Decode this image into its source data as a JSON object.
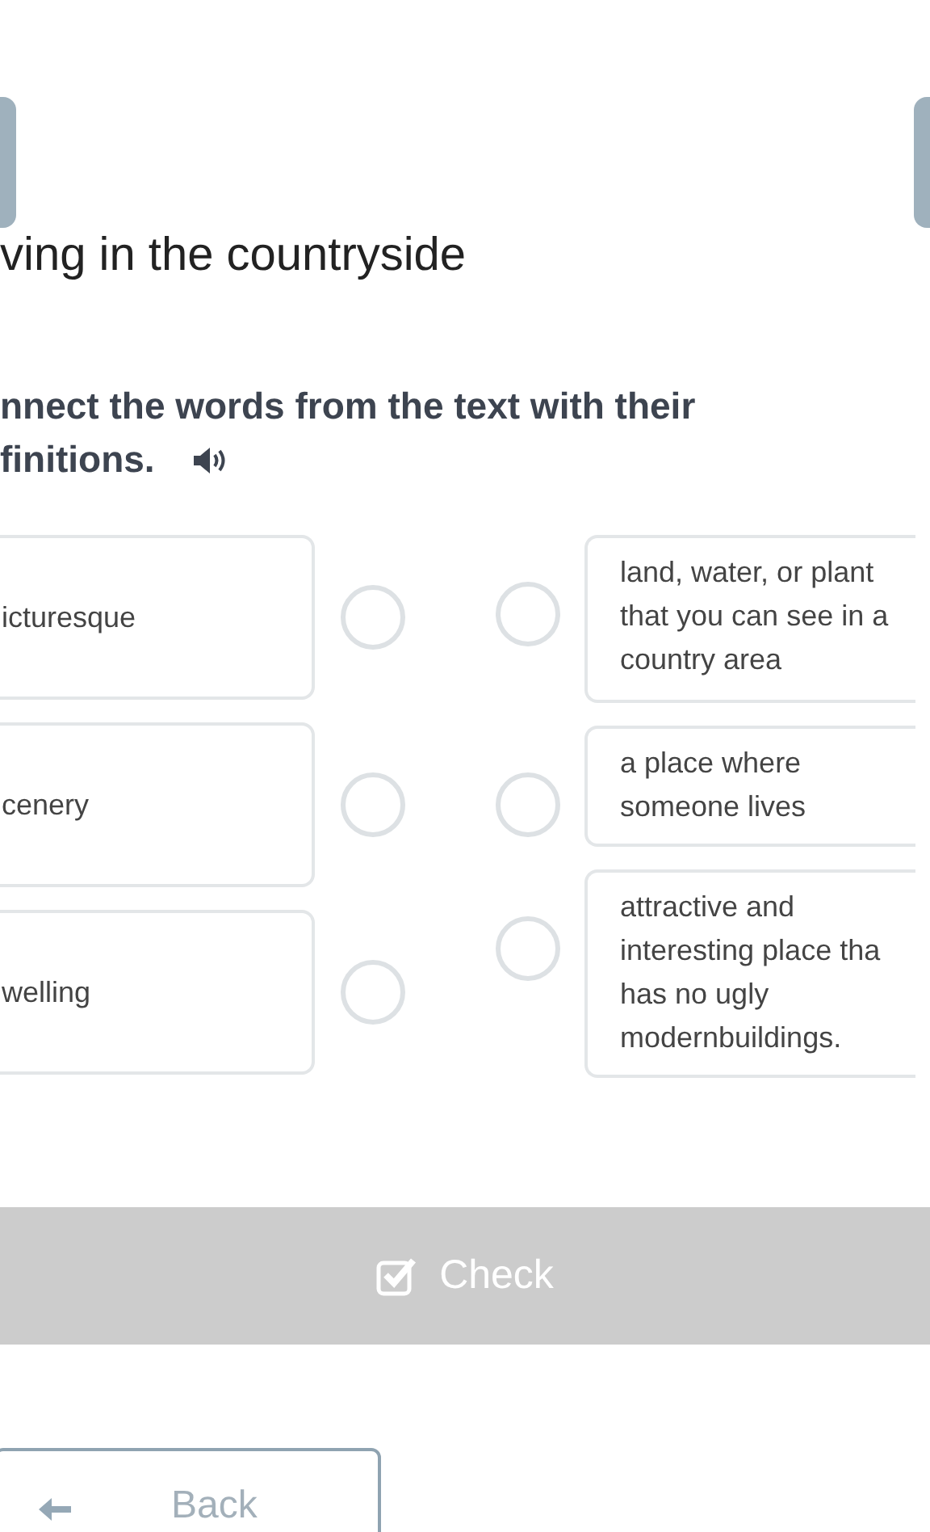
{
  "title": "ving in the countryside",
  "instruction": {
    "lines": [
      "nnect the words from the text with their",
      "finitions."
    ]
  },
  "words": [
    {
      "text": "icturesque"
    },
    {
      "text": "cenery"
    },
    {
      "text": "welling"
    }
  ],
  "definitions": [
    {
      "lines": [
        "land, water, or plant",
        "that you can see in a",
        "country area"
      ]
    },
    {
      "lines": [
        "a place where",
        "someone lives"
      ]
    },
    {
      "lines": [
        "attractive and",
        "interesting place tha",
        "has no ugly",
        "modernbuildings."
      ]
    }
  ],
  "check_button": {
    "label": "Check",
    "disabled": true
  },
  "back_button": {
    "label": "Back"
  }
}
